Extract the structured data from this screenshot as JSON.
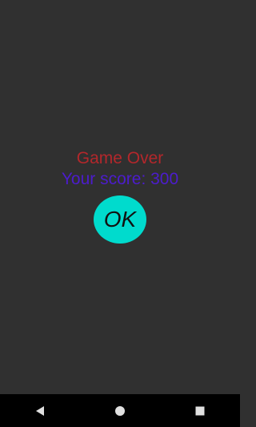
{
  "game_over": {
    "title": "Game Over",
    "score_text": "Your score: 300",
    "ok_label": "OK"
  },
  "colors": {
    "background": "#303030",
    "title": "#b3272b",
    "score": "#4c1ccd",
    "ok_button": "#00dbcd",
    "nav_bar": "#000000",
    "nav_icons": "#e0e0e0"
  },
  "nav": {
    "icons": [
      "back-icon",
      "home-icon",
      "recents-icon"
    ]
  }
}
